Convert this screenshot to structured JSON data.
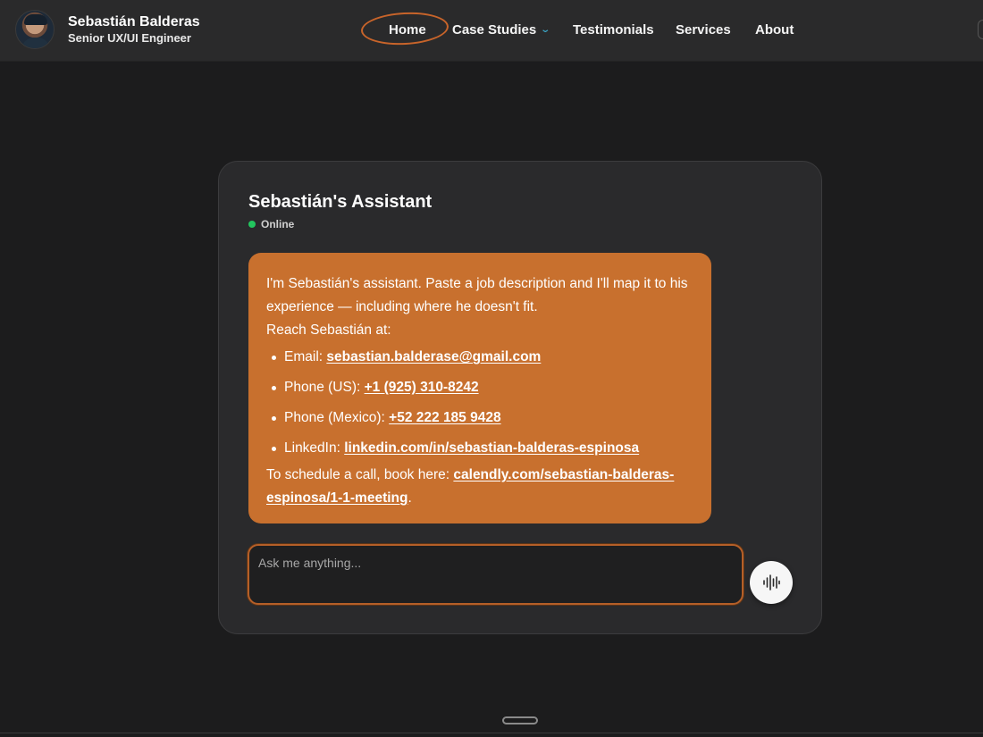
{
  "header": {
    "name": "Sebastián Balderas",
    "role": "Senior UX/UI Engineer",
    "nav": {
      "home": "Home",
      "case_studies": "Case Studies",
      "testimonials": "Testimonials",
      "services": "Services",
      "about": "About"
    },
    "active_nav": "Home",
    "accent_color": "#c8642a"
  },
  "chat": {
    "title": "Sebastián's Assistant",
    "status": "Online",
    "status_color": "#22c55e",
    "message": {
      "intro": "I'm Sebastián's assistant. Paste a job description and I'll map it to his experience — including where he doesn't fit.",
      "reach": "Reach Sebastián at:",
      "contacts": [
        {
          "label": "Email: ",
          "value": "sebastian.balderase@gmail.com"
        },
        {
          "label": "Phone (US): ",
          "value": "+1 (925) 310-8242"
        },
        {
          "label": "Phone (Mexico): ",
          "value": "+52 222 185 9428"
        },
        {
          "label": "LinkedIn: ",
          "value": "linkedin.com/in/sebastian-balderas-espinosa"
        }
      ],
      "schedule_prefix": "To schedule a call, book here: ",
      "schedule_link": "calendly.com/sebastian-balderas-espinosa/1-1-meeting",
      "schedule_suffix": ".",
      "bubble_color": "#c8702e"
    },
    "input": {
      "placeholder": "Ask me anything...",
      "value": ""
    },
    "voice_button_icon": "voice-waveform-icon"
  }
}
